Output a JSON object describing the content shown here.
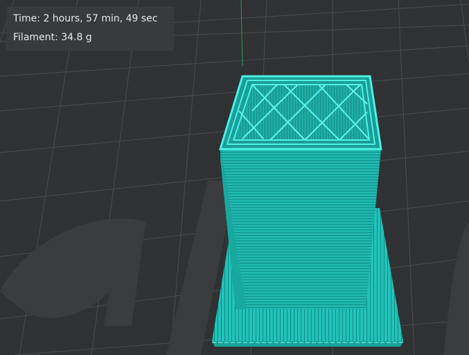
{
  "viewport": {
    "background_color": "#2f3133",
    "grid_color": "#4a4c4e",
    "bed_logo_color": "#3a3c3e",
    "model_color": "#22c6bd",
    "model_dark_color": "#139a93",
    "model_light_color": "#6ef2ea"
  },
  "info": {
    "time_label": "Time:",
    "time_value": "2 hours, 57 min, 49 sec",
    "filament_label": "Filament:",
    "filament_value": "34.8 g"
  }
}
